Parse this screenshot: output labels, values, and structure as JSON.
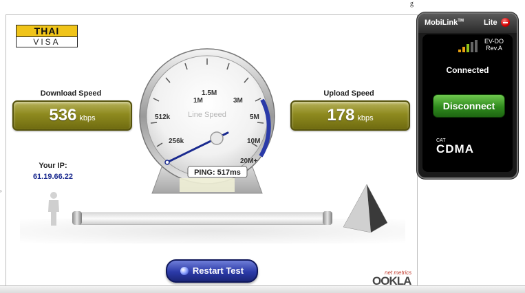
{
  "top_fragment": "g",
  "left_fragment": ",",
  "logo": {
    "line1": "THAI",
    "line2": "VISA"
  },
  "download": {
    "label": "Download Speed",
    "value": "536",
    "unit": "kbps"
  },
  "upload": {
    "label": "Upload Speed",
    "value": "178",
    "unit": "kbps"
  },
  "gauge": {
    "title": "Line Speed",
    "ticks": [
      "256k",
      "512k",
      "1M",
      "1.5M",
      "3M",
      "5M",
      "10M",
      "20M+"
    ],
    "ping_text": "PING: 517ms",
    "needle_value": "536 kbps"
  },
  "ip": {
    "label": "Your IP:",
    "value": "61.19.66.22"
  },
  "restart_label": "Restart Test",
  "ookla": {
    "tag": "net metrics",
    "brand": "OOKLA"
  },
  "mobilink": {
    "title": "MobiLink",
    "tm": "TM",
    "edition": "Lite",
    "network": "EV-DO",
    "revision": "Rev.A",
    "status": "Connected",
    "disconnect_label": "Disconnect",
    "cdma_small": "CAT",
    "cdma_big": "CDMA",
    "signal_bars": 5,
    "signal_level": 3
  },
  "colors": {
    "speed_box": "#8e8a1f",
    "gauge_arc": "#2a3aa8",
    "needle": "#1a2a8f",
    "restart": "#2b3aa8",
    "disconnect": "#2f8a1d",
    "widget_bg": "#1a1a1a"
  },
  "icons": [
    "thai-visa-logo",
    "person-icon",
    "pyramid-icon",
    "close-icon",
    "signal-bars-icon",
    "cat-cdma-logo",
    "ookla-logo"
  ]
}
